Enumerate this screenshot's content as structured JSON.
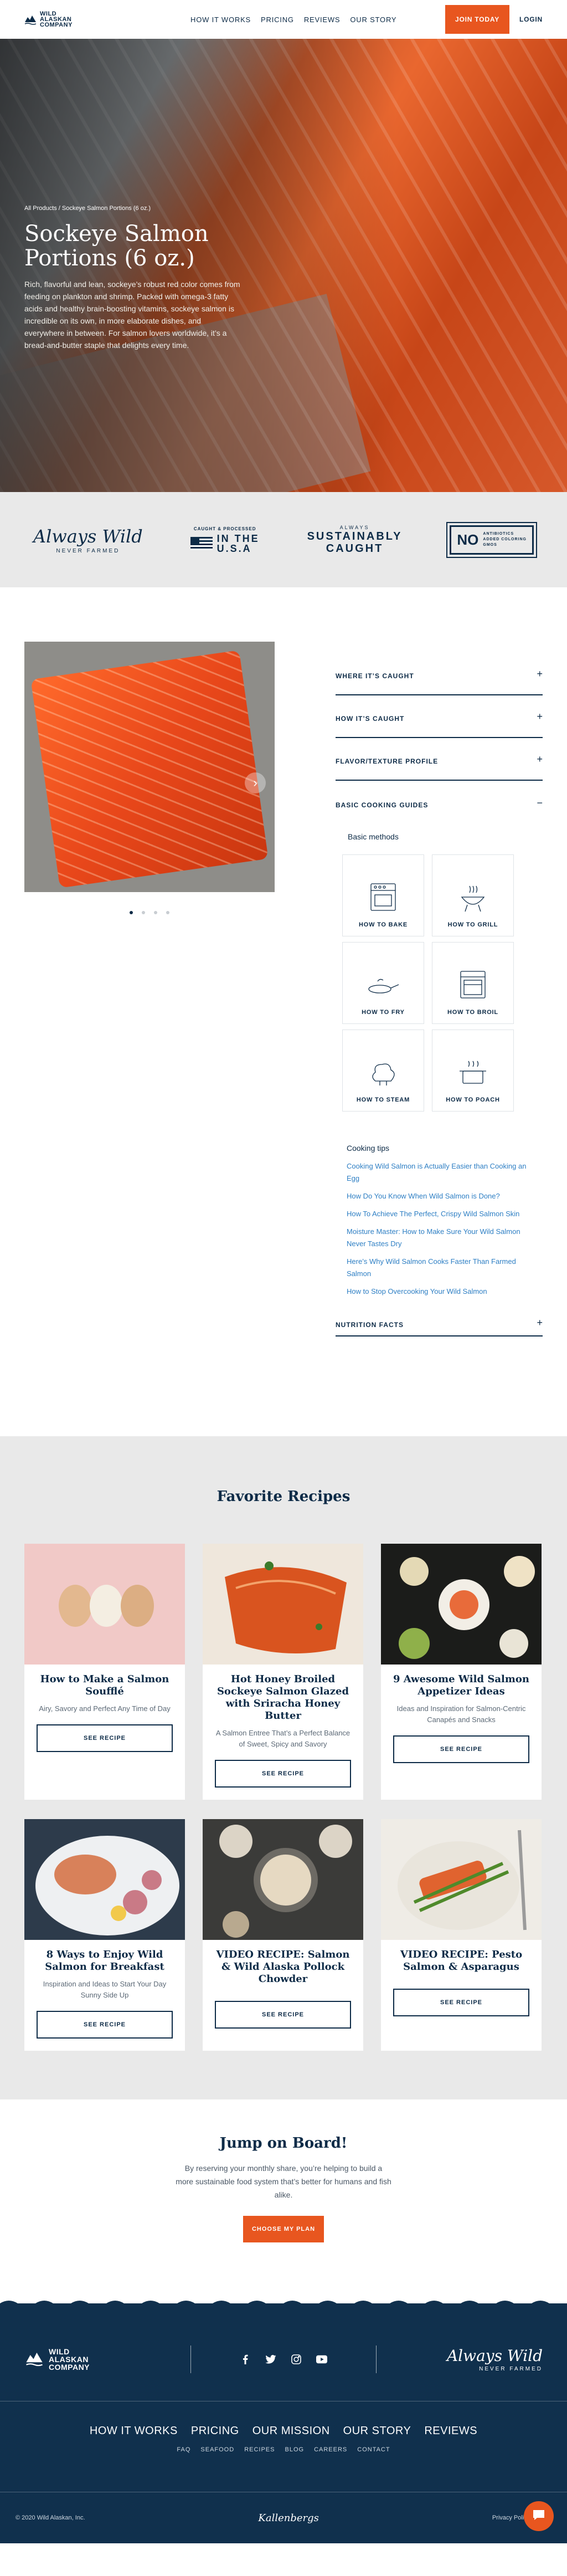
{
  "header": {
    "logo_text": [
      "WILD",
      "ALASKAN",
      "COMPANY"
    ],
    "nav": [
      "HOW IT WORKS",
      "PRICING",
      "REVIEWS",
      "OUR STORY"
    ],
    "cta": "JOIN TODAY",
    "login": "LOGIN"
  },
  "hero": {
    "breadcrumb": "All Products / Sockeye Salmon Portions (6 oz.)",
    "title": "Sockeye Salmon Portions (6 oz.)",
    "description": "Rich, flavorful and lean, sockeye’s robust red color comes from feeding on plankton and shrimp. Packed with omega-3 fatty acids and healthy brain-boosting vitamins, sockeye salmon is incredible on its own, in more elaborate dishes, and everywhere in between. For salmon lovers worldwide, it’s a bread-and-butter staple that delights every time."
  },
  "badges": {
    "always": "Always Wild",
    "never_farmed": "NEVER FARMED",
    "usa_small": "CAUGHT & PROCESSED",
    "usa_big_1": "IN THE",
    "usa_big_2": "U.S.A",
    "sust_small": "ALWAYS",
    "sust_big_1": "SUSTAINABLY",
    "sust_big_2": "CAUGHT",
    "no_big": "NO",
    "no_small": [
      "ANTIBIOTICS",
      "ADDED COLORING",
      "GMOS"
    ]
  },
  "product": {
    "accordion": [
      {
        "label": "WHERE IT’S CAUGHT",
        "sign": "+"
      },
      {
        "label": "HOW IT’S CAUGHT",
        "sign": "+"
      },
      {
        "label": "FLAVOR/TEXTURE PROFILE",
        "sign": "+"
      },
      {
        "label": "BASIC COOKING GUIDES",
        "sign": "−"
      }
    ],
    "basic_methods": "Basic methods",
    "methods": [
      "HOW TO BAKE",
      "HOW TO GRILL",
      "HOW TO FRY",
      "HOW TO BROIL",
      "HOW TO STEAM",
      "HOW TO POACH"
    ],
    "tips_title": "Cooking tips",
    "tips": [
      "Cooking Wild Salmon is Actually Easier than Cooking an Egg",
      "How Do You Know When Wild Salmon is Done?",
      "How To Achieve The Perfect, Crispy Wild Salmon Skin",
      "Moisture Master: How to Make Sure Your Wild Salmon Never Tastes Dry",
      "Here’s Why Wild Salmon Cooks Faster Than Farmed Salmon",
      "How to Stop Overcooking Your Wild Salmon"
    ],
    "nutrition": {
      "label": "NUTRITION FACTS",
      "sign": "+"
    },
    "carousel_dots": 4,
    "carousel_arrow": "›"
  },
  "recipes": {
    "title": "Favorite Recipes",
    "cta": "SEE RECIPE",
    "items": [
      {
        "title": "How to Make a Salmon Soufflé",
        "desc": "Airy, Savory and Perfect Any Time of Day"
      },
      {
        "title": "Hot Honey Broiled Sockeye Salmon Glazed with Sriracha Honey Butter",
        "desc": "A Salmon Entree That’s a Perfect Balance of Sweet, Spicy and Savory"
      },
      {
        "title": "9 Awesome Wild Salmon Appetizer Ideas",
        "desc": "Ideas and Inspiration for Salmon-Centric Canapés and Snacks"
      },
      {
        "title": "8 Ways to Enjoy Wild Salmon for Breakfast",
        "desc": "Inspiration and Ideas to Start Your Day Sunny Side Up"
      },
      {
        "title": "VIDEO RECIPE: Salmon & Wild Alaska Pollock Chowder",
        "desc": ""
      },
      {
        "title": "VIDEO RECIPE: Pesto Salmon & Asparagus",
        "desc": ""
      }
    ]
  },
  "jump": {
    "title": "Jump on Board!",
    "desc": "By reserving your monthly share, you’re helping to build a more sustainable food system that’s better for humans and fish alike.",
    "cta": "CHOOSE MY PLAN"
  },
  "footer": {
    "logo_text": [
      "WILD",
      "ALASKAN",
      "COMPANY"
    ],
    "social": [
      "facebook-icon",
      "twitter-icon",
      "instagram-icon",
      "youtube-icon"
    ],
    "always": "Always Wild",
    "never_farmed": "NEVER FARMED",
    "nav": [
      "HOW IT WORKS",
      "PRICING",
      "OUR MISSION",
      "OUR STORY",
      "REVIEWS"
    ],
    "sub": [
      "FAQ",
      "SEAFOOD",
      "RECIPES",
      "BLOG",
      "CAREERS",
      "CONTACT"
    ],
    "copyright": "© 2020 Wild Alaskan, Inc.",
    "brand": "Kallenbergs",
    "privacy": "Privacy Policy | Terms"
  },
  "colors": {
    "navy": "#0d2b47",
    "orange": "#e8561f",
    "link": "#2e7fc4"
  }
}
